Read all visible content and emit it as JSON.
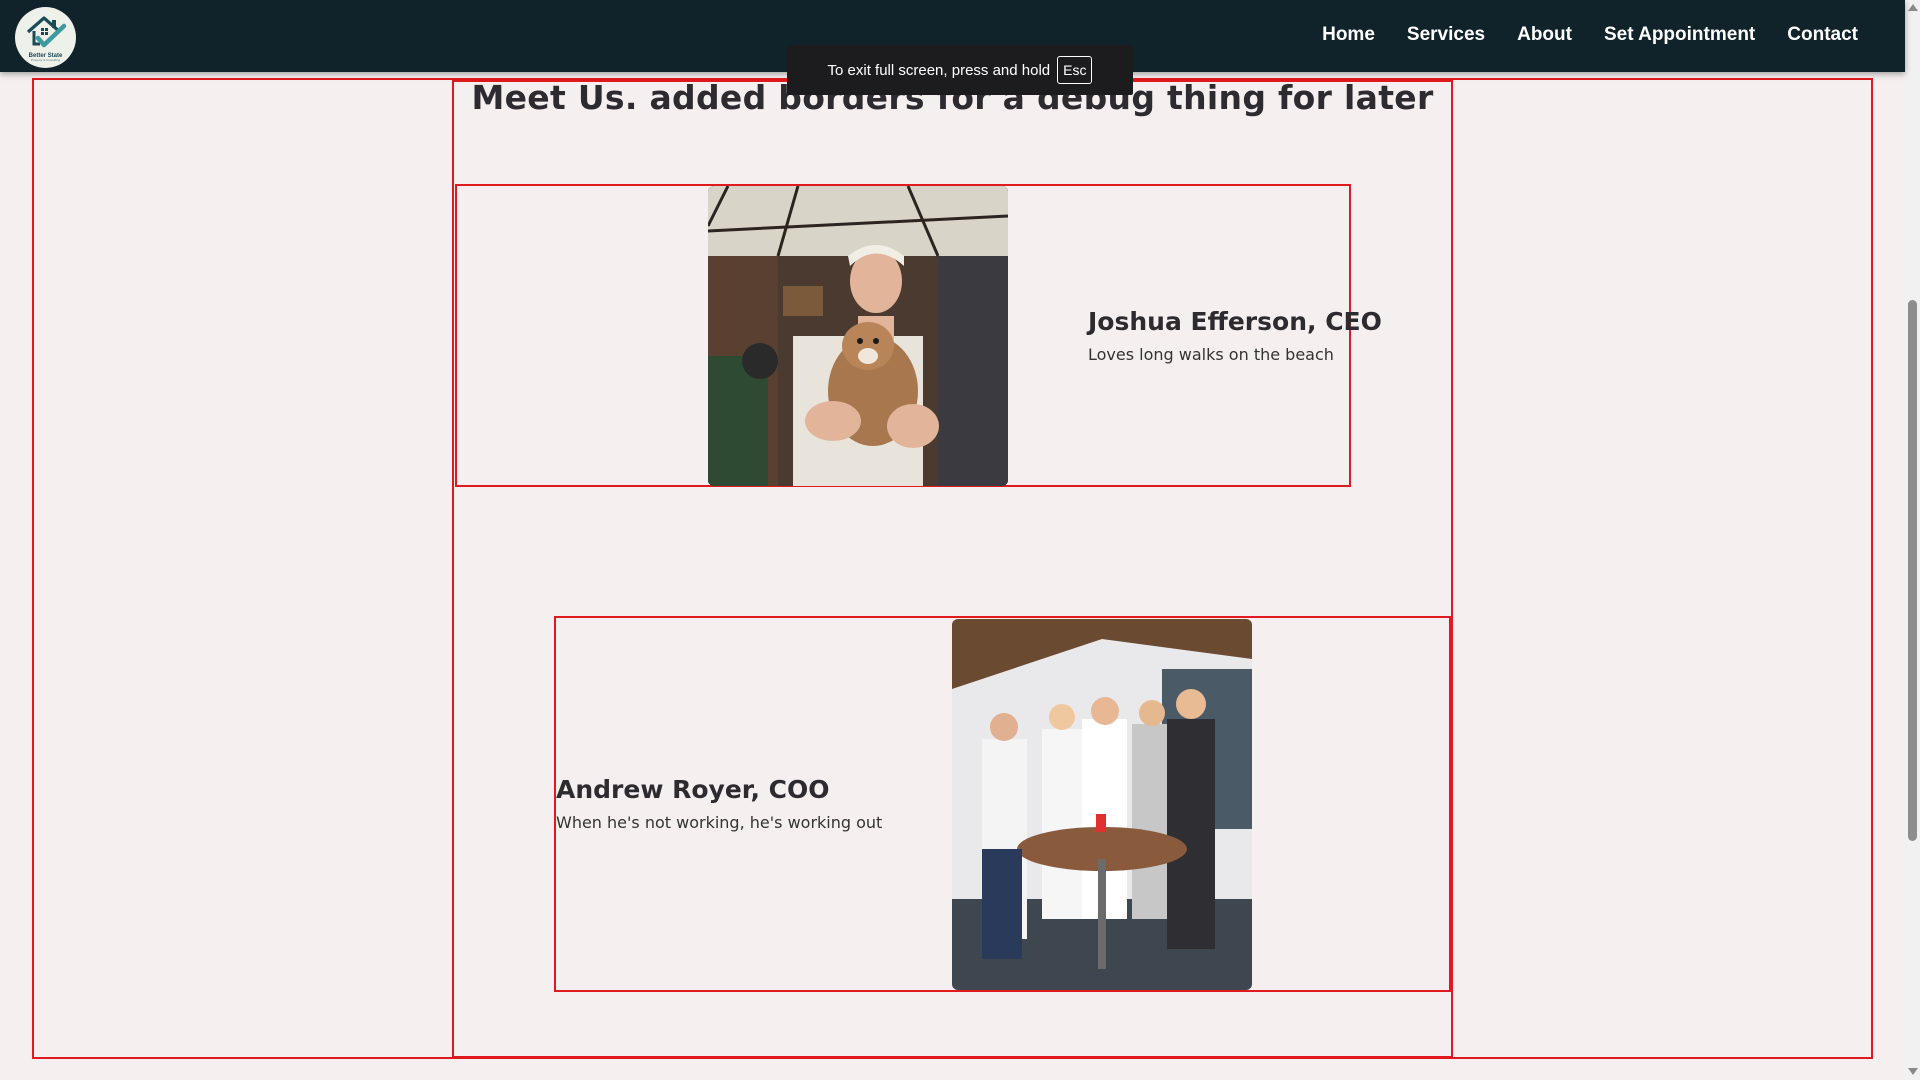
{
  "navbar": {
    "logo_text": "Better State",
    "logo_subtext": "Property & Consulting",
    "links": [
      "Home",
      "Services",
      "About",
      "Set Appointment",
      "Contact"
    ]
  },
  "fullscreen_toast": {
    "message": "To exit full screen, press and hold",
    "key": "Esc"
  },
  "team": {
    "title": "Meet Us. added borders for a debug thing for later",
    "members": [
      {
        "name": "Joshua Efferson, CEO",
        "description": "Loves long walks on the beach"
      },
      {
        "name": "Andrew Royer, COO",
        "description": "When he's not working, he's working out"
      }
    ]
  },
  "colors": {
    "navbar_bg": "#10232a",
    "page_bg": "#f5eff0",
    "debug_border": "#e01a1f"
  }
}
